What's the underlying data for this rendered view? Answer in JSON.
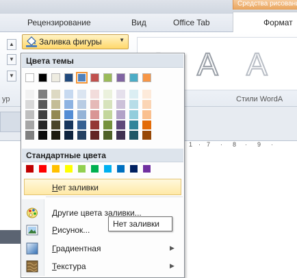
{
  "ribbon": {
    "context_tab": "Средства рисования",
    "tabs": [
      "Рецензирование",
      "Вид",
      "Office Tab",
      "Формат"
    ],
    "shape_fill_label": "Заливка фигуры",
    "left_group_label": "ур",
    "styles_group_label": "Стили WordA",
    "wordart_glyph": "A"
  },
  "ruler": {
    "marks": [
      "1",
      "·",
      "7",
      "·",
      "8",
      "·",
      "9",
      "·"
    ]
  },
  "menu": {
    "theme_colors_header": "Цвета темы",
    "theme_top": [
      "#ffffff",
      "#000000",
      "#eeece1",
      "#1f497d",
      "#4f81bd",
      "#c0504d",
      "#9bbb59",
      "#8064a2",
      "#4bacc6",
      "#f79646"
    ],
    "theme_shades": [
      [
        "#f2f2f2",
        "#d9d9d9",
        "#bfbfbf",
        "#a6a6a6",
        "#808080"
      ],
      [
        "#7f7f7f",
        "#595959",
        "#404040",
        "#262626",
        "#0d0d0d"
      ],
      [
        "#ddd9c3",
        "#c4bd97",
        "#938953",
        "#494429",
        "#1d1b10"
      ],
      [
        "#c6d9f0",
        "#8db3e2",
        "#548dd4",
        "#17365d",
        "#0f243e"
      ],
      [
        "#dbe5f1",
        "#b8cce4",
        "#95b3d7",
        "#366092",
        "#244061"
      ],
      [
        "#f2dcdb",
        "#e5b9b7",
        "#d99694",
        "#953734",
        "#632423"
      ],
      [
        "#ebf1dd",
        "#d7e3bc",
        "#c3d69b",
        "#76923c",
        "#4f6128"
      ],
      [
        "#e5e0ec",
        "#ccc1d9",
        "#b2a2c7",
        "#5f497a",
        "#3f3151"
      ],
      [
        "#dbeef3",
        "#b7dde8",
        "#92cddc",
        "#31859b",
        "#205867"
      ],
      [
        "#fdeada",
        "#fbd5b5",
        "#fac08f",
        "#e36c09",
        "#974806"
      ]
    ],
    "selected_theme_index": 4,
    "standard_colors_header": "Стандартные цвета",
    "standard": [
      "#c00000",
      "#ff0000",
      "#ffc000",
      "#ffff00",
      "#92d050",
      "#00b050",
      "#00b0f0",
      "#0070c0",
      "#002060",
      "#7030a0"
    ],
    "no_fill_label": "Нет заливки",
    "no_fill_accel": "Н",
    "no_fill_rest": "ет заливки",
    "more_colors_label": "Другие цвета заливки...",
    "more_colors_accel": "Д",
    "more_colors_rest": "ругие цвета заливки...",
    "picture_accel": "Р",
    "picture_rest": "исунок...",
    "gradient_accel": "Г",
    "gradient_rest": "радиентная",
    "texture_accel": "Т",
    "texture_rest": "екстура"
  },
  "tooltip": {
    "text": "Нет заливки"
  }
}
